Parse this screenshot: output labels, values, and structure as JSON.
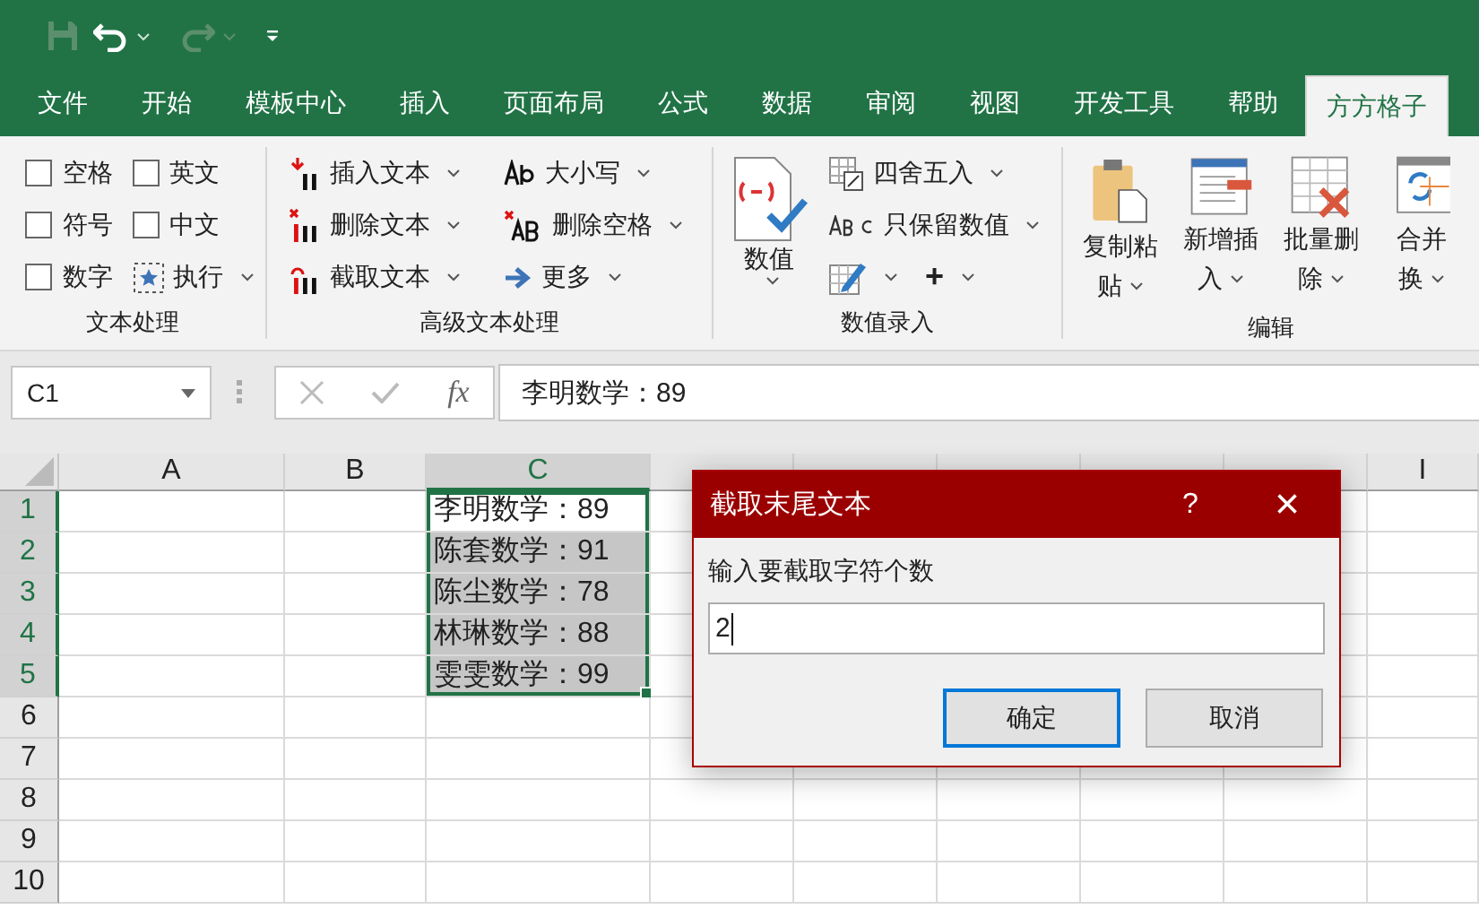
{
  "menu_tabs": [
    {
      "label": "文件",
      "selected": false
    },
    {
      "label": "开始",
      "selected": false
    },
    {
      "label": "模板中心",
      "selected": false
    },
    {
      "label": "插入",
      "selected": false
    },
    {
      "label": "页面布局",
      "selected": false
    },
    {
      "label": "公式",
      "selected": false
    },
    {
      "label": "数据",
      "selected": false
    },
    {
      "label": "审阅",
      "selected": false
    },
    {
      "label": "视图",
      "selected": false
    },
    {
      "label": "开发工具",
      "selected": false
    },
    {
      "label": "帮助",
      "selected": false
    },
    {
      "label": "方方格子",
      "selected": true
    }
  ],
  "ribbon": {
    "text_group": {
      "title": "文本处理",
      "items": [
        {
          "kind": "checkbox",
          "label": "空格",
          "checked": false
        },
        {
          "kind": "checkbox",
          "label": "符号",
          "checked": false
        },
        {
          "kind": "checkbox",
          "label": "数字",
          "checked": false
        },
        {
          "kind": "checkbox",
          "label": "英文",
          "checked": false
        },
        {
          "kind": "checkbox",
          "label": "中文",
          "checked": false
        },
        {
          "kind": "menu",
          "label": "执行"
        }
      ]
    },
    "advanced_group": {
      "title": "高级文本处理",
      "items": [
        "插入文本",
        "删除文本",
        "截取文本",
        "大小写",
        "删除空格",
        "更多"
      ]
    },
    "number_group": {
      "title": "数值录入",
      "big_button": "数值",
      "items": [
        {
          "kind": "menu",
          "label": "四舍五入"
        },
        {
          "kind": "menu",
          "label": "只保留数值"
        },
        {
          "kind": "icon_menu"
        },
        {
          "kind": "menu",
          "label": "+"
        }
      ]
    },
    "edit_group": {
      "title": "编辑",
      "buttons": [
        {
          "line1": "复制粘",
          "line2": "贴"
        },
        {
          "line1": "新增插",
          "line2": "入"
        },
        {
          "line1": "批量删",
          "line2": "除"
        },
        {
          "line1": "合并",
          "line2": "换"
        }
      ]
    }
  },
  "name_box": "C1",
  "function_label": "fx",
  "formula": "李明数学：89",
  "sheet": {
    "columns": [
      {
        "label": "A",
        "selected": false
      },
      {
        "label": "B",
        "selected": false
      },
      {
        "label": "C",
        "selected": true
      },
      {
        "selected": false
      },
      {
        "selected": false
      },
      {
        "selected": false
      },
      {
        "selected": false
      },
      {
        "selected": false
      },
      {
        "label": "I",
        "selected": false
      }
    ],
    "rows": [
      {
        "label": "1",
        "selected": true,
        "value": "李明数学：89",
        "active": true
      },
      {
        "label": "2",
        "selected": true,
        "value": "陈套数学：91",
        "active": false
      },
      {
        "label": "3",
        "selected": true,
        "value": "陈尘数学：78",
        "active": false
      },
      {
        "label": "4",
        "selected": true,
        "value": "林琳数学：88",
        "active": false
      },
      {
        "label": "5",
        "selected": true,
        "value": "雯雯数学：99",
        "active": false
      },
      {
        "label": "6",
        "selected": false
      },
      {
        "label": "7",
        "selected": false
      },
      {
        "label": "8",
        "selected": false
      },
      {
        "label": "9",
        "selected": false
      },
      {
        "label": "10",
        "selected": false
      }
    ]
  },
  "dialog": {
    "title": "截取末尾文本",
    "help": "?",
    "close": "×",
    "prompt": "输入要截取字符个数",
    "value": "2",
    "buttons": [
      {
        "label": "确定",
        "selected": true
      },
      {
        "label": "取消",
        "selected": false
      }
    ]
  }
}
